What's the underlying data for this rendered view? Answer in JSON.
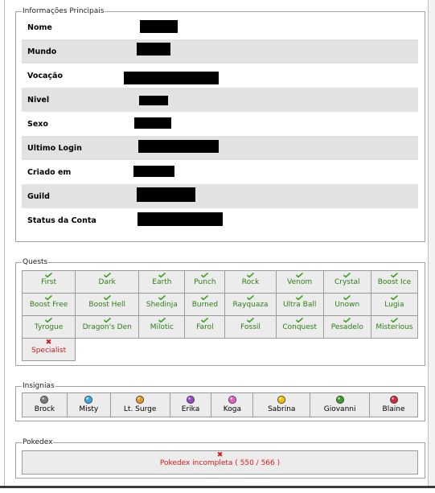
{
  "info": {
    "legend": "Informações Principais",
    "rows": [
      {
        "label": "Nome"
      },
      {
        "label": "Mundo"
      },
      {
        "label": "Vocação"
      },
      {
        "label": "Nivel"
      },
      {
        "label": "Sexo"
      },
      {
        "label": "Ultimo Login"
      },
      {
        "label": "Criado em"
      },
      {
        "label": "Guild"
      },
      {
        "label": "Status da Conta"
      }
    ]
  },
  "quests": {
    "legend": "Quests",
    "rows": [
      [
        "First",
        "Dark",
        "Earth",
        "Punch",
        "Rock",
        "Venom",
        "Crystal",
        "Boost Ice"
      ],
      [
        "Boost Free",
        "Boost Hell",
        "Shedinja",
        "Burned",
        "Rayquaza",
        "Ultra Ball",
        "Unown",
        "Lugia"
      ],
      [
        "Tyrogue",
        "Dragon's Den",
        "Milotic",
        "Farol",
        "Fossil",
        "Conquest",
        "Pesadelo",
        "Misterious"
      ]
    ],
    "incomplete": [
      "Specialist"
    ],
    "complete_color": "#2e7d16",
    "incomplete_color": "#d81818"
  },
  "insignias": {
    "legend": "Insignias",
    "badges": [
      {
        "name": "Brock",
        "icon": "boulder-badge-icon",
        "color": "#7a7a7a"
      },
      {
        "name": "Misty",
        "icon": "cascade-badge-icon",
        "color": "#39a7e8"
      },
      {
        "name": "Lt. Surge",
        "icon": "thunder-badge-icon",
        "color": "#e39a23"
      },
      {
        "name": "Erika",
        "icon": "rainbow-badge-icon",
        "color": "#9a46c8"
      },
      {
        "name": "Koga",
        "icon": "soul-badge-icon",
        "color": "#e85bc9"
      },
      {
        "name": "Sabrina",
        "icon": "marsh-badge-icon",
        "color": "#f0c000"
      },
      {
        "name": "Giovanni",
        "icon": "earth-badge-icon",
        "color": "#3f9a2c"
      },
      {
        "name": "Blaine",
        "icon": "volcano-badge-icon",
        "color": "#d4283c"
      }
    ]
  },
  "pokedex": {
    "legend": "Pokedex",
    "status": "Pokedex incompleta ( 550 / 566 )"
  }
}
